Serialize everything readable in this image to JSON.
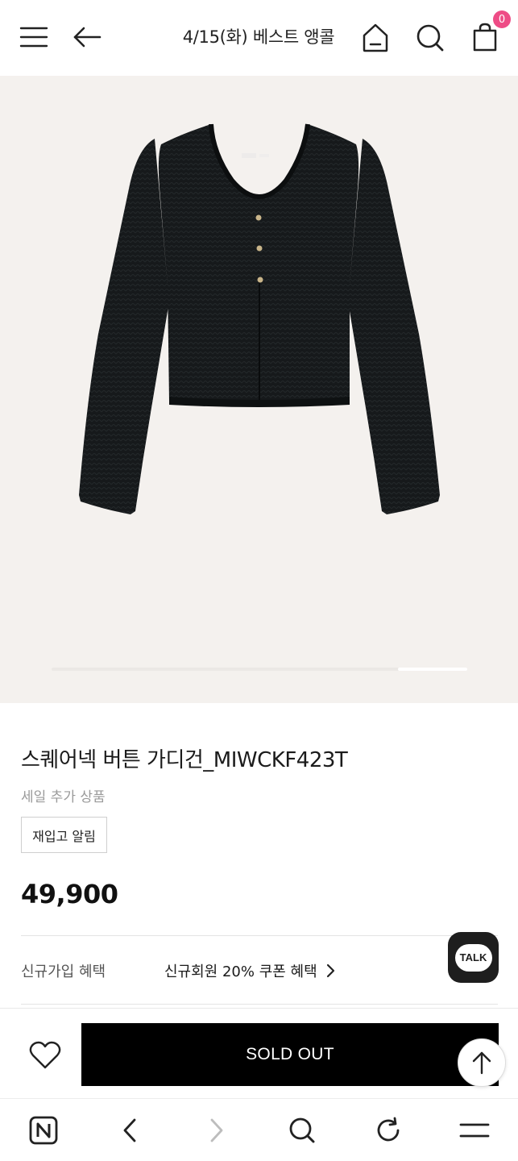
{
  "header": {
    "title": "4/15(화) 베스트 앵콜",
    "cart_count": "0",
    "icons": [
      "menu-icon",
      "back-arrow-icon",
      "home-icon",
      "search-icon",
      "cart-icon"
    ]
  },
  "gallery": {
    "image_alt": "black knit cardigan",
    "current_slide_fraction": 0.83
  },
  "product": {
    "name": "스퀘어넥 버튼 가디건_MIWCKF423T",
    "tag": "세일 추가 상품",
    "restock_label": "재입고 알림",
    "price": "49,900"
  },
  "benefit": {
    "label": "신규가입 혜택",
    "value": "신규회원 20% 쿠폰 혜택"
  },
  "talk": {
    "label": "TALK"
  },
  "actions": {
    "soldout_label": "SOLD OUT"
  },
  "colors": {
    "badge": "#ee4c86",
    "gallery_bg": "#f4f1ee",
    "soldout_bg": "#000000"
  }
}
